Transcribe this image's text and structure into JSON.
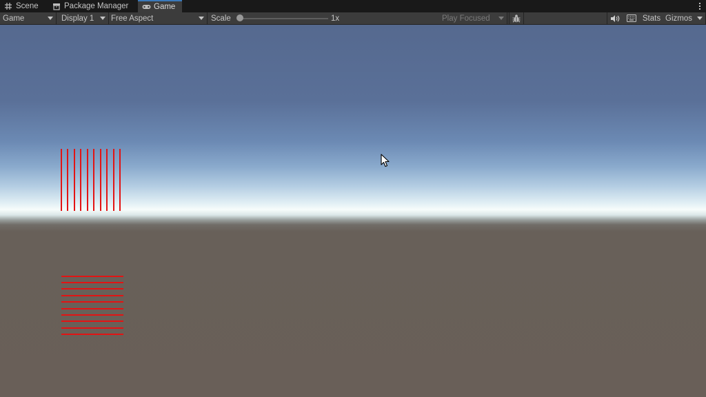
{
  "tabs": [
    {
      "label": "Scene",
      "icon": "grid-icon",
      "active": false
    },
    {
      "label": "Package Manager",
      "icon": "package-icon",
      "active": false
    },
    {
      "label": "Game",
      "icon": "gamepad-icon",
      "active": true
    }
  ],
  "toolbar": {
    "view_mode": "Game",
    "display": "Display 1",
    "aspect": "Free Aspect",
    "scale_label": "Scale",
    "scale_value": "1x",
    "scale_level": 0,
    "play_mode": "Play Focused",
    "stats_label": "Stats",
    "gizmos_label": "Gizmos"
  },
  "colors": {
    "accent": "#3a79bb",
    "line_red": "#e31313",
    "ground": "#695f58",
    "sky_top": "#55698f"
  }
}
